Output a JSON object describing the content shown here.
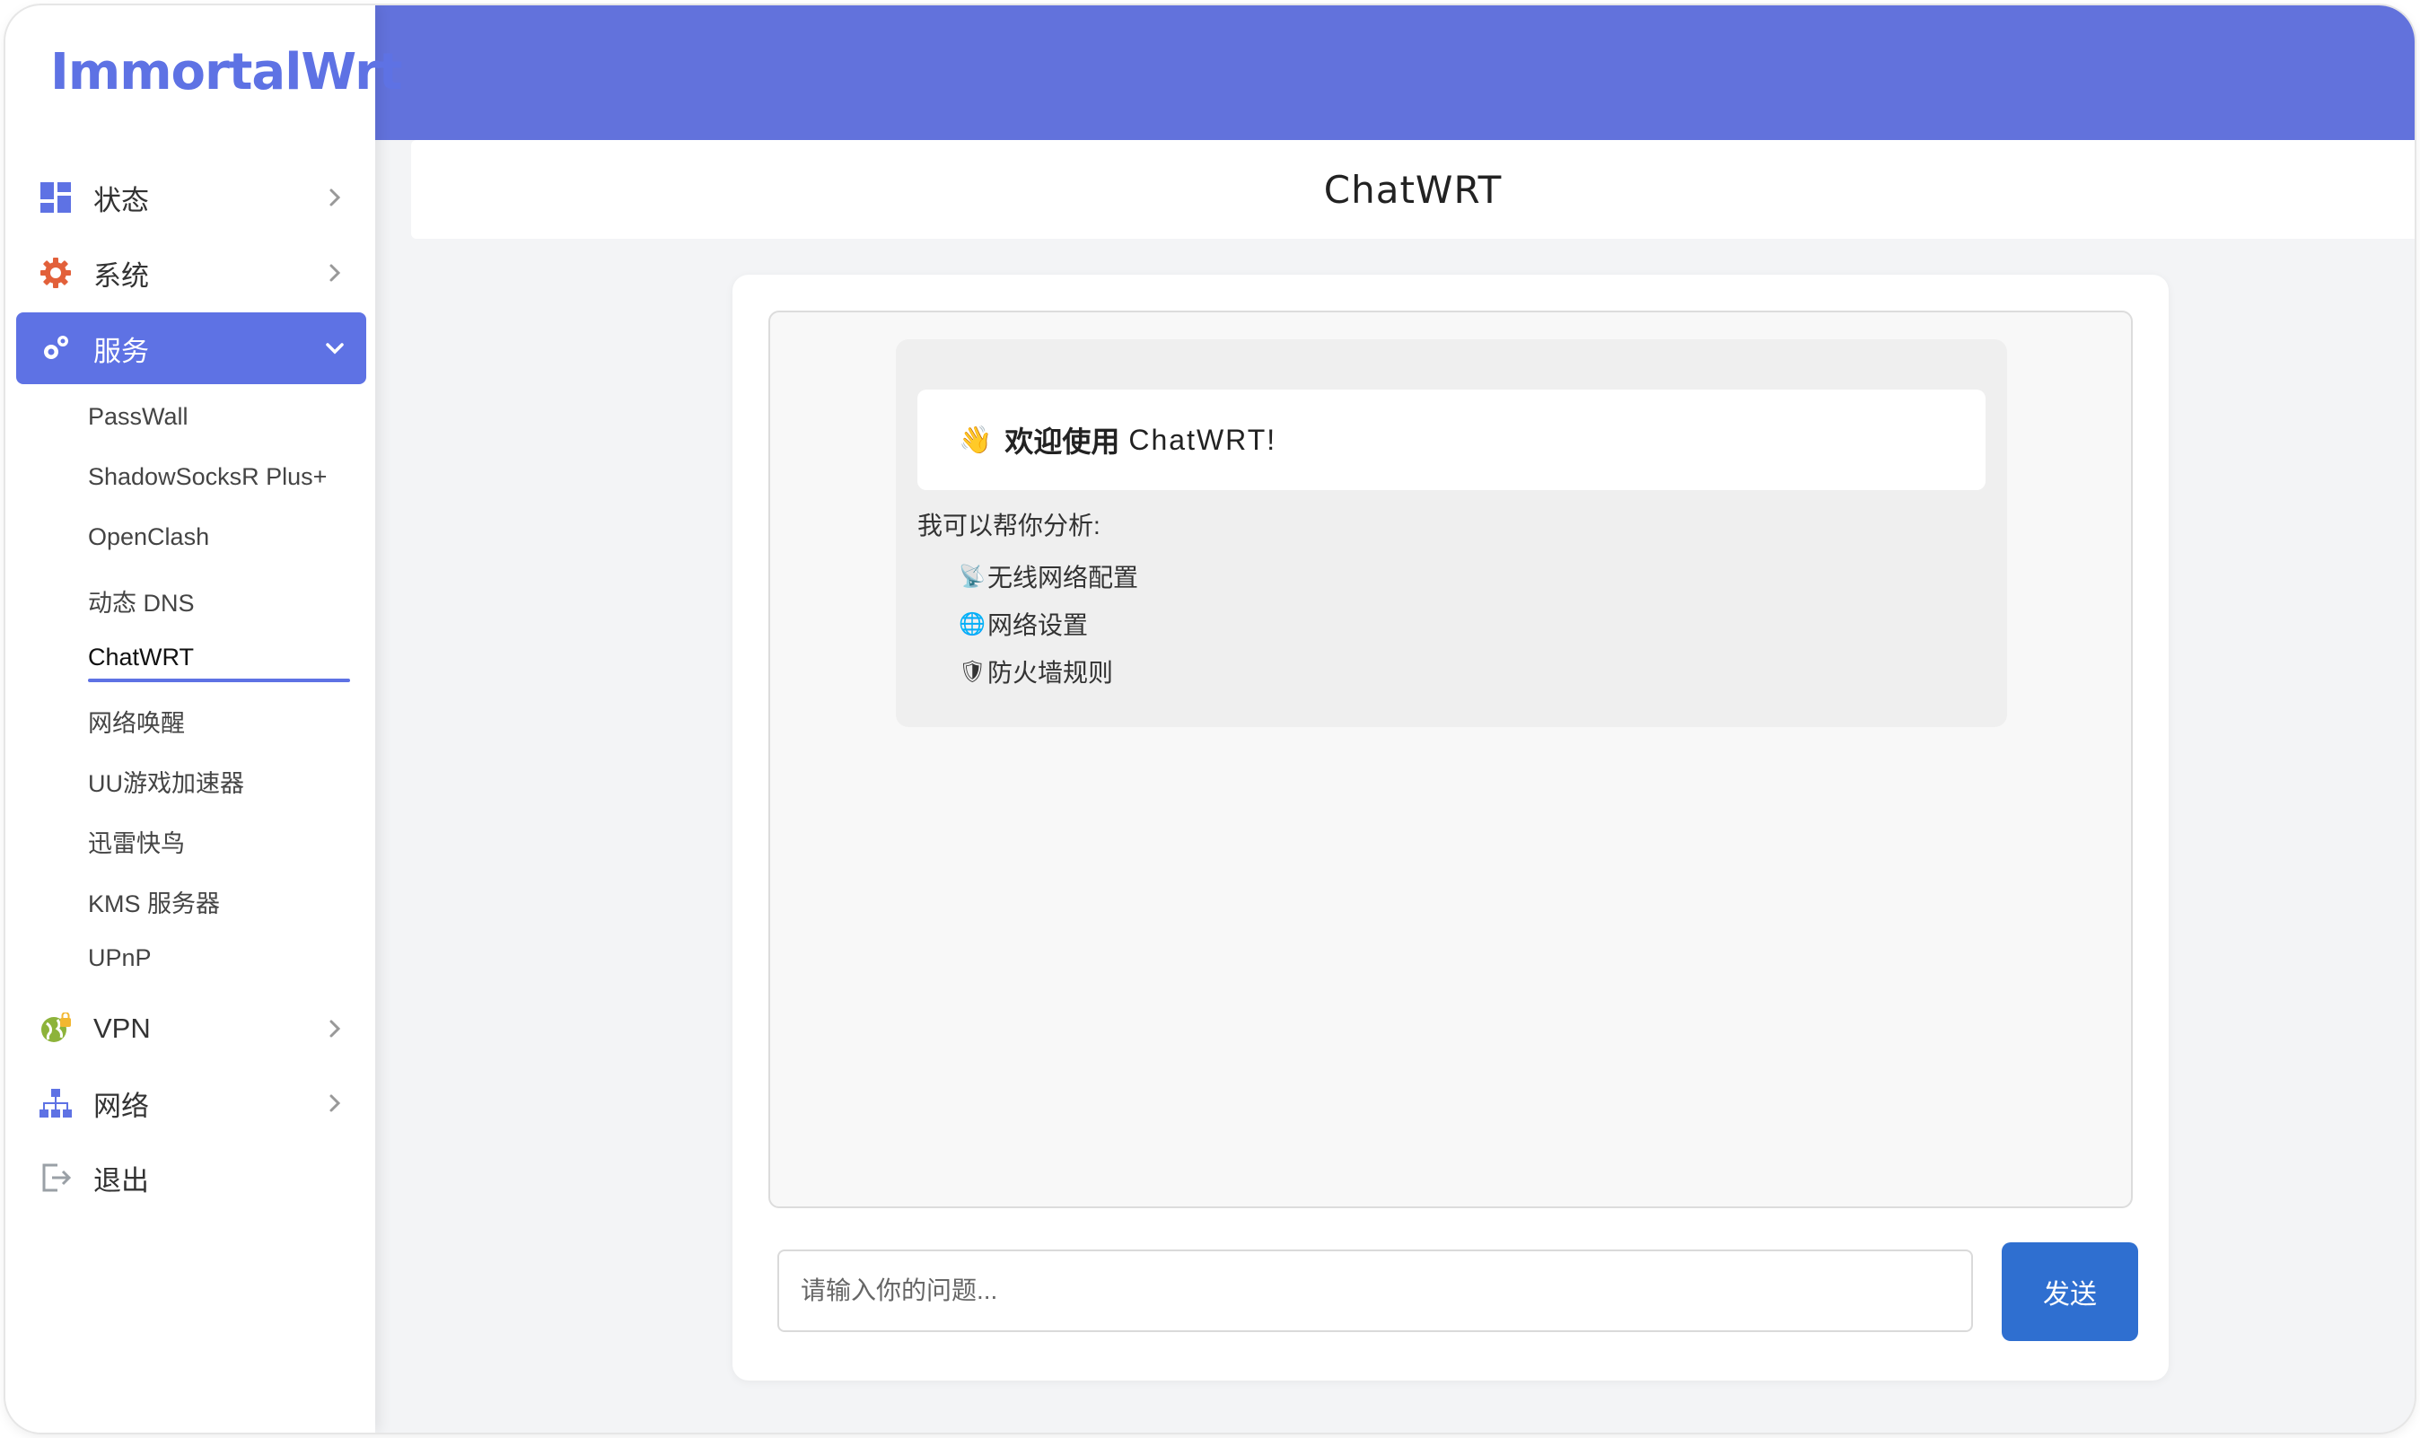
{
  "brand": {
    "logo_text": "ImmortalWrt",
    "accent": "#5e72e4"
  },
  "sidebar": {
    "items": [
      {
        "label": "状态",
        "icon": "dashboard-icon",
        "expanded": false
      },
      {
        "label": "系统",
        "icon": "gear-icon",
        "expanded": false
      },
      {
        "label": "服务",
        "icon": "gears-icon",
        "expanded": true
      },
      {
        "label": "VPN",
        "icon": "globe-lock-icon",
        "expanded": false
      },
      {
        "label": "网络",
        "icon": "network-tree-icon",
        "expanded": false
      },
      {
        "label": "退出",
        "icon": "logout-icon",
        "expanded": false
      }
    ],
    "service_submenu": [
      "PassWall",
      "ShadowSocksR Plus+",
      "OpenClash",
      "动态 DNS",
      "ChatWRT",
      "网络唤醒",
      "UU游戏加速器",
      "迅雷快鸟",
      "KMS 服务器",
      "UPnP"
    ],
    "current_submenu": "ChatWRT"
  },
  "page": {
    "title": "ChatWRT"
  },
  "chat": {
    "welcome_emoji": "👋",
    "welcome_bold": "欢迎使用",
    "welcome_brand": "ChatWRT!",
    "intro": "我可以帮你分析:",
    "features": [
      {
        "emoji": "📡",
        "text": "无线网络配置"
      },
      {
        "emoji": "🌐",
        "text": "网络设置"
      },
      {
        "emoji": "🛡",
        "text": "防火墙规则"
      }
    ]
  },
  "composer": {
    "placeholder": "请输入你的问题...",
    "value": "",
    "send_label": "发送"
  }
}
